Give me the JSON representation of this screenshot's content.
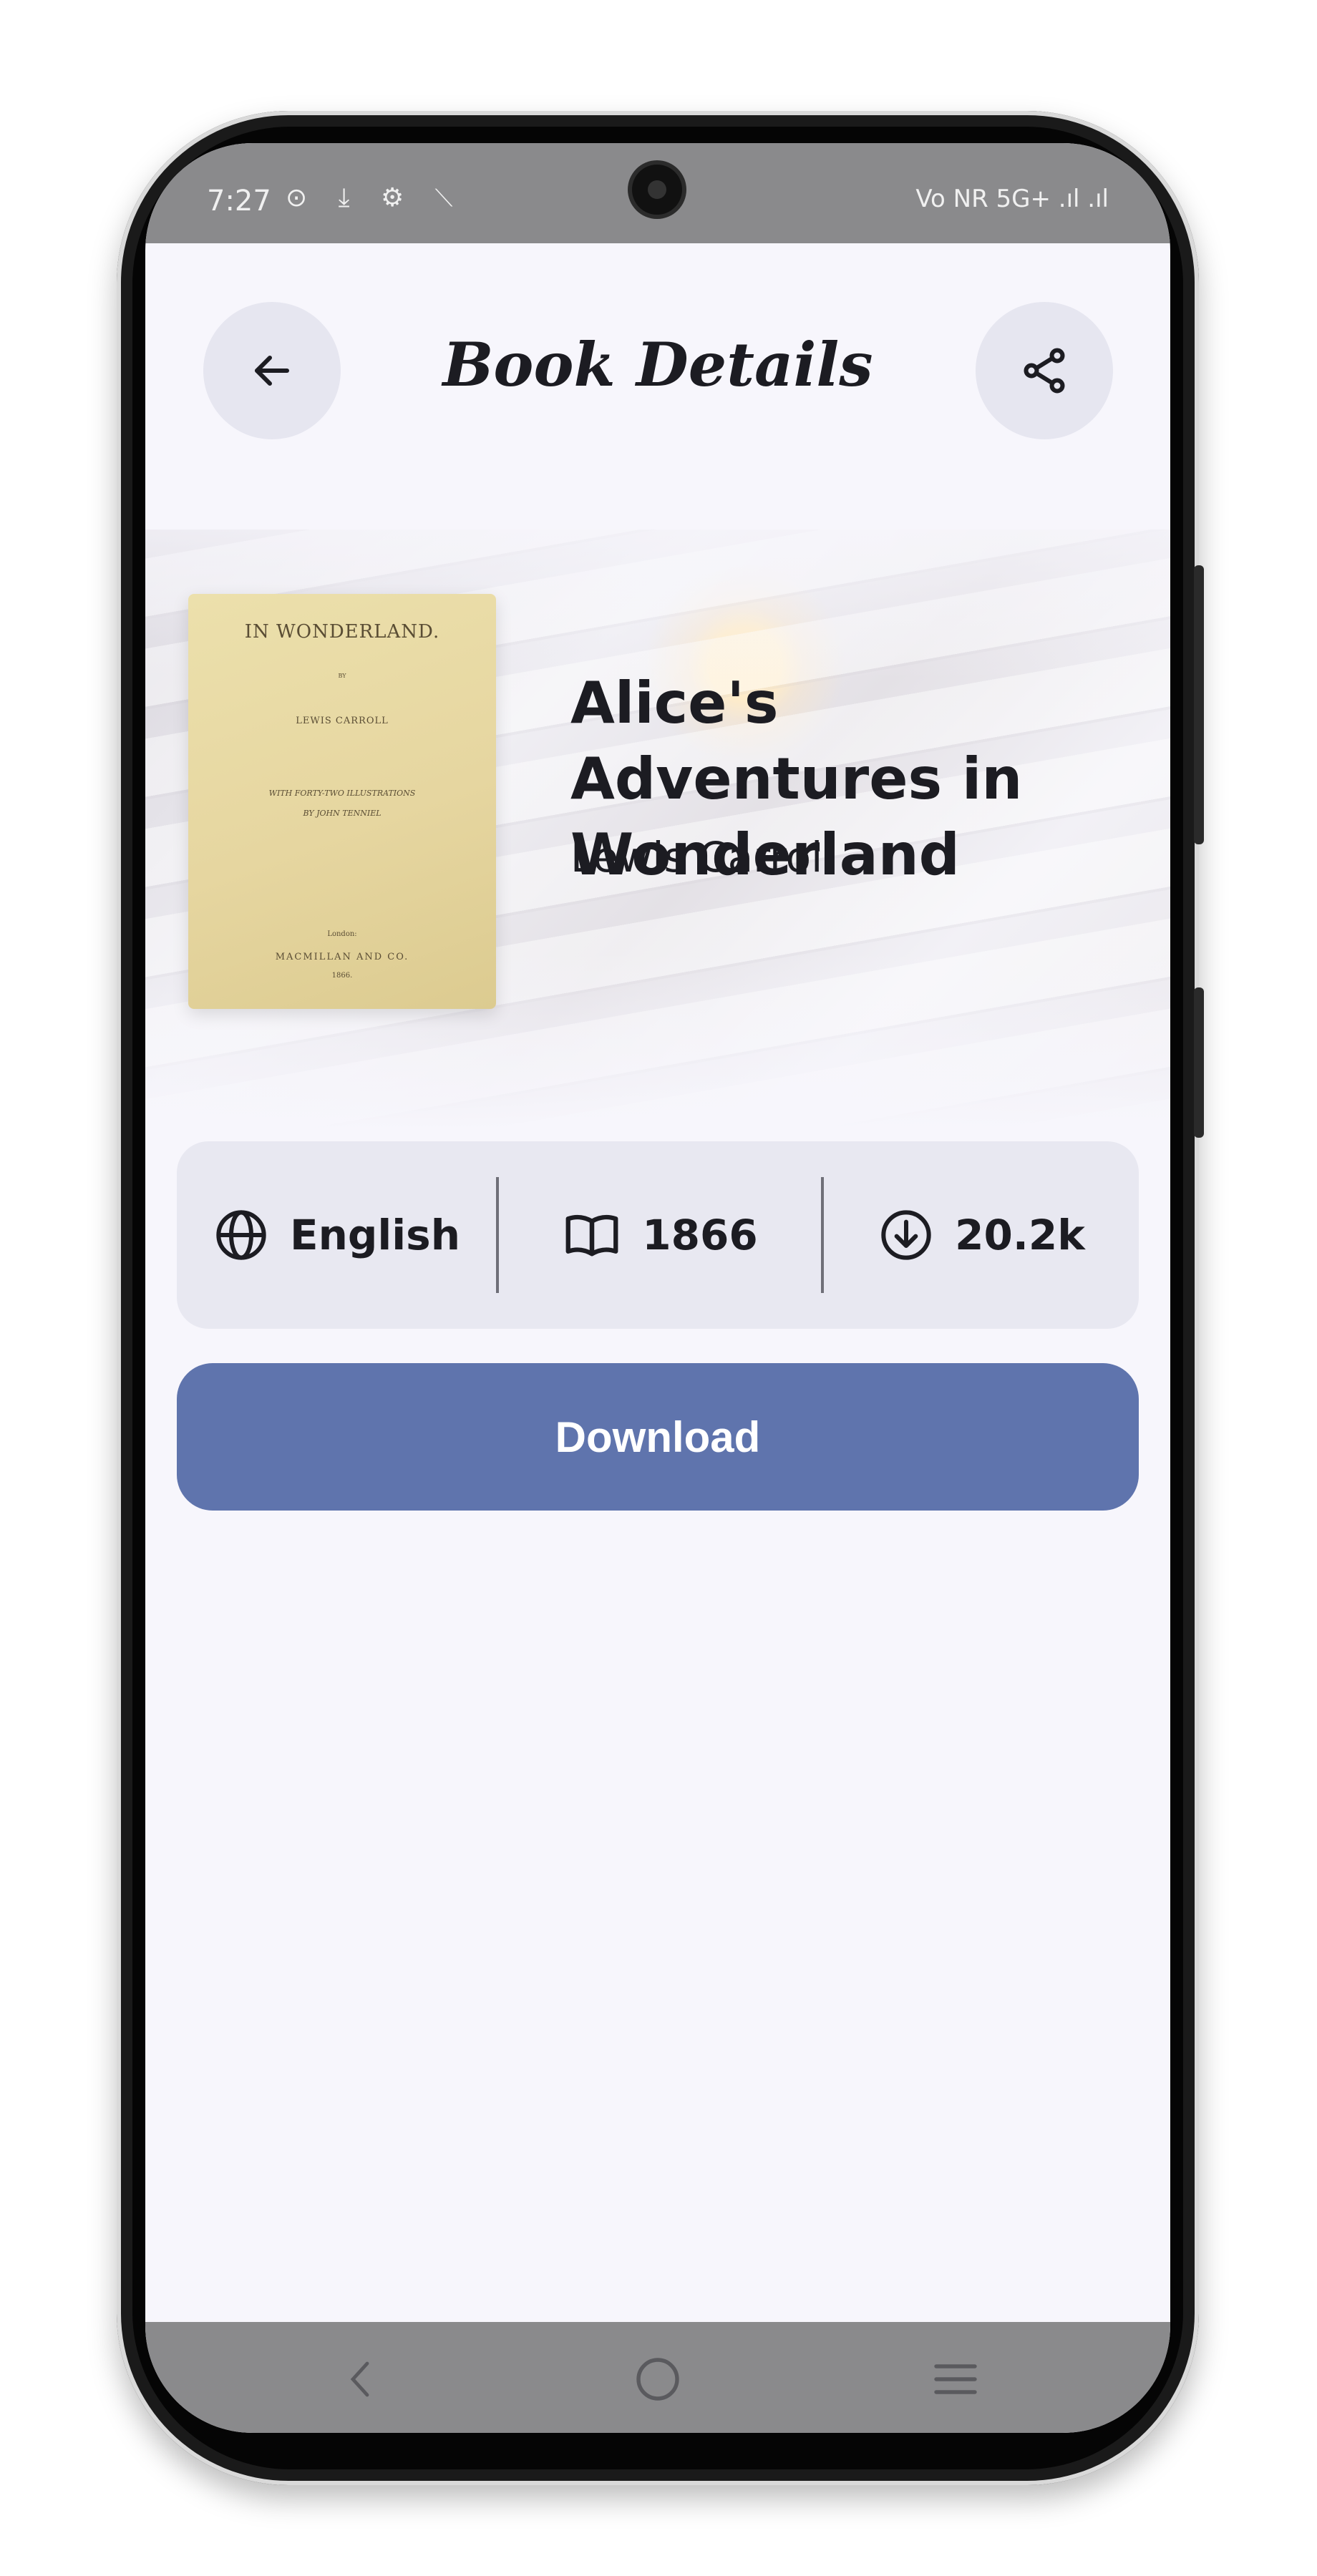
{
  "status_bar": {
    "time": "7:27",
    "left_icons": "⊙ ⤓ ⚙ ⟍",
    "right_text": "Vo NR 5G+ .ıl .ıl"
  },
  "header": {
    "title": "Book Details",
    "back_icon": "arrow-left-icon",
    "share_icon": "share-icon"
  },
  "book": {
    "title": "Alice's Adventures in Wonderland",
    "author": "Lewis Carroll",
    "cover": {
      "line1": "IN WONDERLAND.",
      "line2": "BY",
      "line3": "LEWIS CARROLL",
      "line4": "WITH FORTY-TWO ILLUSTRATIONS",
      "line5": "BY JOHN TENNIEL",
      "line6": "London:",
      "line7": "MACMILLAN AND CO.",
      "line8": "1866."
    }
  },
  "info": {
    "language": "English",
    "year": "1866",
    "downloads": "20.2k"
  },
  "actions": {
    "download_label": "Download"
  },
  "colors": {
    "accent": "#5f74ad",
    "background": "#f7f6fc",
    "info_bar": "#e8e8f1"
  }
}
